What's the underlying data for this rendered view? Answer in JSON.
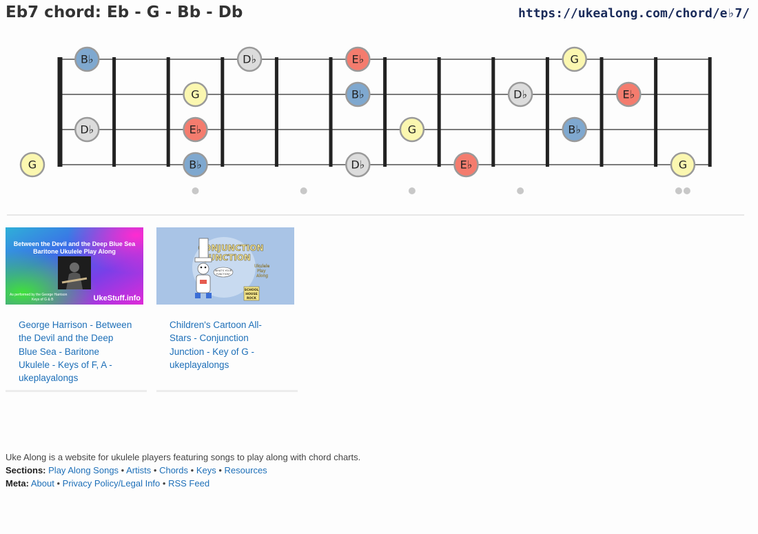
{
  "header": {
    "title": "Eb7 chord: Eb - G - Bb - Db",
    "url": "https://ukealong.com/chord/e♭7/"
  },
  "fretboard": {
    "strings": 4,
    "frets": 12,
    "inlay_frets": [
      3,
      5,
      7,
      9,
      12
    ],
    "note_colors": {
      "Eb": "#f47c6e",
      "G": "#fbf7b0",
      "Bb": "#7fa8cf",
      "Db": "#dcdcdc"
    },
    "notes": [
      {
        "string": 1,
        "fret": 1,
        "note": "Bb",
        "label": "B♭"
      },
      {
        "string": 1,
        "fret": 4,
        "note": "Db",
        "label": "D♭"
      },
      {
        "string": 1,
        "fret": 6,
        "note": "Eb",
        "label": "E♭"
      },
      {
        "string": 1,
        "fret": 10,
        "note": "G",
        "label": "G"
      },
      {
        "string": 2,
        "fret": 3,
        "note": "G",
        "label": "G"
      },
      {
        "string": 2,
        "fret": 6,
        "note": "Bb",
        "label": "B♭"
      },
      {
        "string": 2,
        "fret": 9,
        "note": "Db",
        "label": "D♭"
      },
      {
        "string": 2,
        "fret": 11,
        "note": "Eb",
        "label": "E♭"
      },
      {
        "string": 3,
        "fret": 1,
        "note": "Db",
        "label": "D♭"
      },
      {
        "string": 3,
        "fret": 3,
        "note": "Eb",
        "label": "E♭"
      },
      {
        "string": 3,
        "fret": 7,
        "note": "G",
        "label": "G"
      },
      {
        "string": 3,
        "fret": 10,
        "note": "Bb",
        "label": "B♭"
      },
      {
        "string": 4,
        "fret": 0,
        "note": "G",
        "label": "G"
      },
      {
        "string": 4,
        "fret": 3,
        "note": "Bb",
        "label": "B♭"
      },
      {
        "string": 4,
        "fret": 6,
        "note": "Db",
        "label": "D♭"
      },
      {
        "string": 4,
        "fret": 8,
        "note": "Eb",
        "label": "E♭"
      },
      {
        "string": 4,
        "fret": 12,
        "note": "G",
        "label": "G"
      }
    ]
  },
  "videos": [
    {
      "caption": "George Harrison - Between the Devil and the Deep Blue Sea - Baritone Ukulele - Keys of F, A - ukeplayalongs",
      "thumb_line1": "Between the Devil and the Deep Blue Sea",
      "thumb_line2": "Baritone Ukulele Play Along",
      "thumb_credit1": "As performed by the George Harrison",
      "thumb_credit2": "Keys of G & B",
      "thumb_brand": "UkeStuff.info"
    },
    {
      "caption": "Children's Cartoon All-Stars - Conjunction Junction - Key of G - ukeplayalongs",
      "thumb_title1": "CONJUNCTION",
      "thumb_title2": "JUNCTION",
      "thumb_side1": "Ukulele",
      "thumb_side2": "Play",
      "thumb_side3": "Along",
      "thumb_bubble1": "WHAT'S YOUR",
      "thumb_bubble2": "FUNCTION?",
      "thumb_logo1": "SCHOOL",
      "thumb_logo2": "HOUSE",
      "thumb_logo3": "ROCK"
    }
  ],
  "footer": {
    "description": "Uke Along is a website for ukulele players featuring songs to play along with chord charts.",
    "sections_label": "Sections:",
    "sections": [
      "Play Along Songs",
      "Artists",
      "Chords",
      "Keys",
      "Resources"
    ],
    "meta_label": "Meta:",
    "meta": [
      "About",
      "Privacy Policy/Legal Info",
      "RSS Feed"
    ],
    "separator": "•"
  }
}
